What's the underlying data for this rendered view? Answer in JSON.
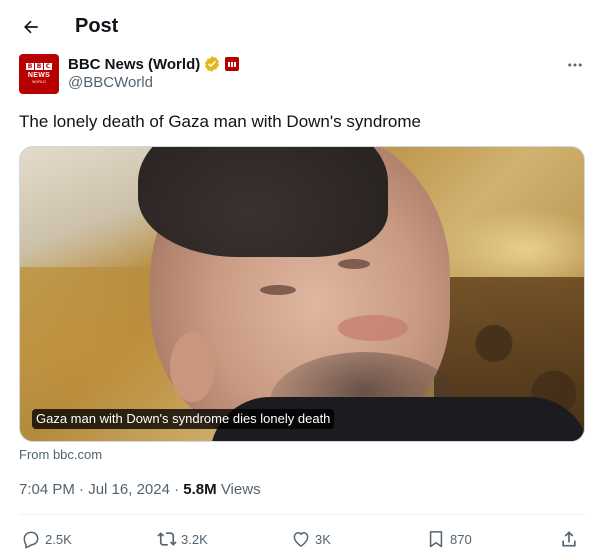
{
  "header": {
    "title": "Post"
  },
  "author": {
    "name": "BBC News (World)",
    "handle": "@BBCWorld",
    "avatar": {
      "letters": [
        "B",
        "B",
        "C"
      ],
      "line1": "NEWS",
      "line2": "WORLD"
    }
  },
  "tweet": {
    "text": "The lonely death of Gaza man with Down's syndrome",
    "card_caption": "Gaza man with Down's syndrome dies lonely death",
    "card_source": "From bbc.com",
    "time": "7:04 PM",
    "date": "Jul 16, 2024",
    "views_count": "5.8M",
    "views_label": "Views"
  },
  "actions": {
    "replies": "2.5K",
    "reposts": "3.2K",
    "likes": "3K",
    "bookmarks": "870"
  },
  "colors": {
    "brand_red": "#b80000",
    "verified_gold": "#e2b719",
    "secondary_text": "#536471"
  }
}
